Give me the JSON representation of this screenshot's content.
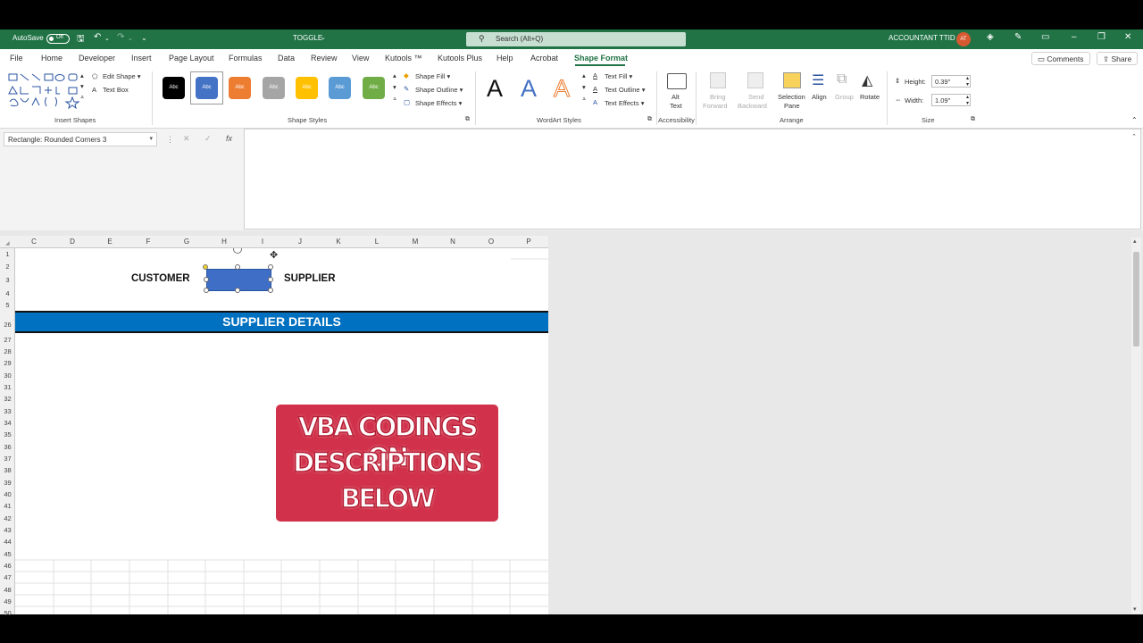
{
  "titlebar": {
    "autosave_label": "AutoSave",
    "autosave_state": "Off",
    "file_name": "TOGGLE",
    "search_placeholder": "Search (Alt+Q)",
    "account_name": "ACCOUNTANT TTID",
    "avatar_initials": "AT"
  },
  "menu": {
    "tabs": [
      "File",
      "Home",
      "Developer",
      "Insert",
      "Page Layout",
      "Formulas",
      "Data",
      "Review",
      "View",
      "Kutools ™",
      "Kutools Plus",
      "Help",
      "Acrobat",
      "Shape Format"
    ],
    "active_tab": "Shape Format",
    "comments_label": "Comments",
    "share_label": "Share"
  },
  "ribbon": {
    "insert_shapes": {
      "edit_shape": "Edit Shape",
      "text_box": "Text Box",
      "group_label": "Insert Shapes"
    },
    "shape_styles": {
      "swatch_label": "Abc",
      "swatch_colors": [
        "#000000",
        "#4472c4",
        "#ed7d31",
        "#a5a5a5",
        "#ffc000",
        "#5b9bd5",
        "#70ad47"
      ],
      "shape_fill": "Shape Fill",
      "shape_outline": "Shape Outline",
      "shape_effects": "Shape Effects",
      "group_label": "Shape Styles"
    },
    "wordart": {
      "letter": "A",
      "text_fill": "Text Fill",
      "text_outline": "Text Outline",
      "text_effects": "Text Effects",
      "group_label": "WordArt Styles"
    },
    "accessibility": {
      "alt_text_1": "Alt",
      "alt_text_2": "Text",
      "group_label": "Accessibility"
    },
    "arrange": {
      "bring_forward_1": "Bring",
      "bring_forward_2": "Forward",
      "send_backward_1": "Send",
      "send_backward_2": "Backward",
      "selection_pane_1": "Selection",
      "selection_pane_2": "Pane",
      "align": "Align",
      "group": "Group",
      "rotate": "Rotate",
      "group_label": "Arrange"
    },
    "size": {
      "height_label": "Height:",
      "height_value": "0.39\"",
      "width_label": "Width:",
      "width_value": "1.09\"",
      "group_label": "Size"
    }
  },
  "formula_bar": {
    "name_box": "Rectangle: Rounded Corners 3",
    "fx": "fx",
    "cancel": "✕",
    "enter": "✓"
  },
  "sheet": {
    "columns": [
      "C",
      "D",
      "E",
      "F",
      "G",
      "H",
      "I",
      "J",
      "K",
      "L",
      "M",
      "N",
      "O",
      "P"
    ],
    "rows": [
      "1",
      "2",
      "3",
      "4",
      "5",
      "26",
      "27",
      "28",
      "29",
      "30",
      "31",
      "32",
      "33",
      "34",
      "35",
      "36",
      "37",
      "38",
      "39",
      "40",
      "41",
      "42",
      "43",
      "44",
      "45",
      "46",
      "47",
      "48",
      "49",
      "50"
    ],
    "customer_label": "CUSTOMER",
    "supplier_label": "SUPPLIER",
    "banner_title": "SUPPLIER DETAILS",
    "note_lines": [
      "VBA CODINGS ON",
      "DESCRIPTIONS",
      "BELOW"
    ]
  }
}
